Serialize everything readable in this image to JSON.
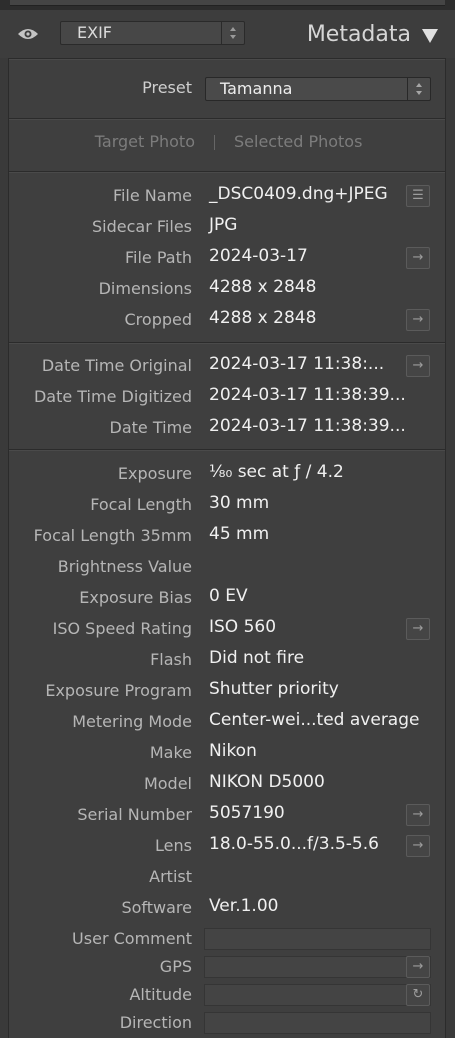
{
  "header": {
    "view_selector": "EXIF",
    "panel_title": "Metadata"
  },
  "preset": {
    "label": "Preset",
    "value": "Tamanna"
  },
  "target": {
    "target_photo": "Target Photo",
    "selected_photos": "Selected Photos"
  },
  "file_rows": [
    {
      "label": "File Name",
      "value": "_DSC0409.dng+JPEG",
      "button": "list-icon"
    },
    {
      "label": "Sidecar Files",
      "value": "JPG"
    },
    {
      "label": "File Path",
      "value": "2024-03-17",
      "button": "arrow-icon"
    },
    {
      "label": "Dimensions",
      "value": "4288 x 2848"
    },
    {
      "label": "Cropped",
      "value": "4288 x 2848",
      "button": "arrow-icon"
    }
  ],
  "date_rows": [
    {
      "label": "Date Time Original",
      "value": "2024-03-17 11:38:...",
      "button": "arrow-icon"
    },
    {
      "label": "Date Time Digitized",
      "value": "2024-03-17 11:38:39..."
    },
    {
      "label": "Date Time",
      "value": "2024-03-17 11:38:39..."
    }
  ],
  "exif_rows": [
    {
      "label": "Exposure",
      "value": "¹⁄₈₀ sec at ƒ / 4.2"
    },
    {
      "label": "Focal Length",
      "value": "30 mm"
    },
    {
      "label": "Focal Length 35mm",
      "value": "45 mm"
    },
    {
      "label": "Brightness Value",
      "value": ""
    },
    {
      "label": "Exposure Bias",
      "value": "0 EV"
    },
    {
      "label": "ISO Speed Rating",
      "value": "ISO 560",
      "button": "arrow-icon"
    },
    {
      "label": "Flash",
      "value": "Did not fire"
    },
    {
      "label": "Exposure Program",
      "value": "Shutter priority"
    },
    {
      "label": "Metering Mode",
      "value": "Center-wei...ted average"
    },
    {
      "label": "Make",
      "value": "Nikon"
    },
    {
      "label": "Model",
      "value": "NIKON D5000"
    },
    {
      "label": "Serial Number",
      "value": "5057190",
      "button": "arrow-icon"
    },
    {
      "label": "Lens",
      "value": "18.0-55.0...f/3.5-5.6",
      "button": "arrow-icon"
    },
    {
      "label": "Artist",
      "value": ""
    },
    {
      "label": "Software",
      "value": "Ver.1.00"
    }
  ],
  "field_rows": [
    {
      "label": "User Comment"
    },
    {
      "label": "GPS",
      "button": "arrow-icon"
    },
    {
      "label": "Altitude",
      "button": "refresh-icon"
    },
    {
      "label": "Direction"
    }
  ]
}
